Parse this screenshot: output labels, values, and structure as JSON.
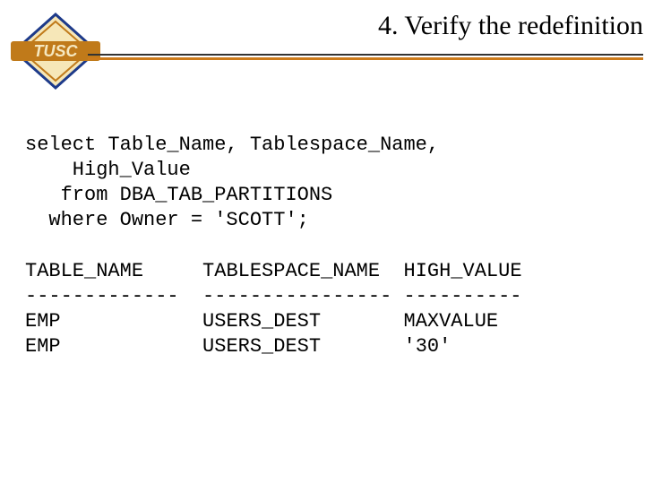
{
  "title": "4. Verify the redefinition",
  "logo": {
    "text": "TUSC"
  },
  "sql": {
    "line1": "select Table_Name, Tablespace_Name,",
    "line2": "    High_Value",
    "line3": "   from DBA_TAB_PARTITIONS",
    "line4": "  where Owner = 'SCOTT';"
  },
  "result": {
    "h1": "TABLE_NAME",
    "h2": "TABLESPACE_NAME",
    "h3": "HIGH_VALUE",
    "d1": "-------------",
    "d2": "----------------",
    "d3": "----------",
    "r1c1": "EMP",
    "r1c2": "USERS_DEST",
    "r1c3": "MAXVALUE",
    "r2c1": "EMP",
    "r2c2": "USERS_DEST",
    "r2c3": "'30'"
  }
}
